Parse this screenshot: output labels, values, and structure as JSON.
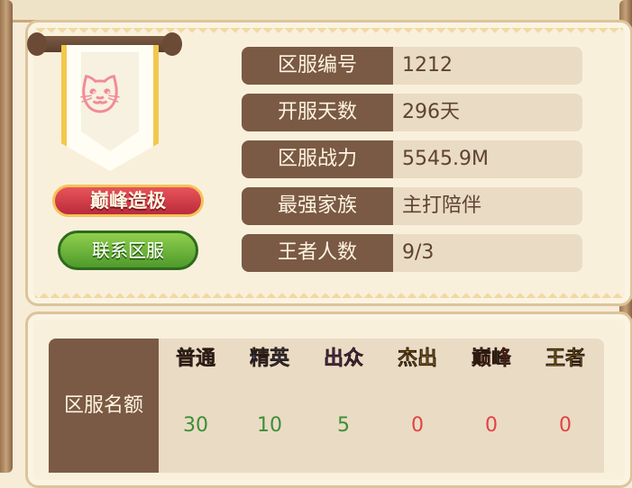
{
  "banner": {
    "title_badge": "巅峰造极"
  },
  "contact_button": {
    "label": "联系区服"
  },
  "server_info": [
    {
      "label": "区服编号",
      "value": "1212"
    },
    {
      "label": "开服天数",
      "value": "296天"
    },
    {
      "label": "区服战力",
      "value": "5545.9M"
    },
    {
      "label": "最强家族",
      "value": "主打陪伴"
    },
    {
      "label": "王者人数",
      "value": "9/3"
    }
  ],
  "quota": {
    "row_label": "区服名额",
    "tiers": [
      {
        "name": "普通",
        "value": "30",
        "color": "#2f3d55",
        "value_color": "#3d8f34"
      },
      {
        "name": "精英",
        "value": "10",
        "color": "#2f63c7",
        "value_color": "#3d8f34"
      },
      {
        "name": "出众",
        "value": "5",
        "color": "#7a3bd1",
        "value_color": "#3d8f34"
      },
      {
        "name": "杰出",
        "value": "0",
        "color": "#f0b61b",
        "value_color": "#e24343"
      },
      {
        "name": "巅峰",
        "value": "0",
        "color": "#e02e3a",
        "value_color": "#e24343"
      },
      {
        "name": "王者",
        "value": "0",
        "color": "#f0c21c",
        "value_color": "#e24343"
      }
    ]
  }
}
